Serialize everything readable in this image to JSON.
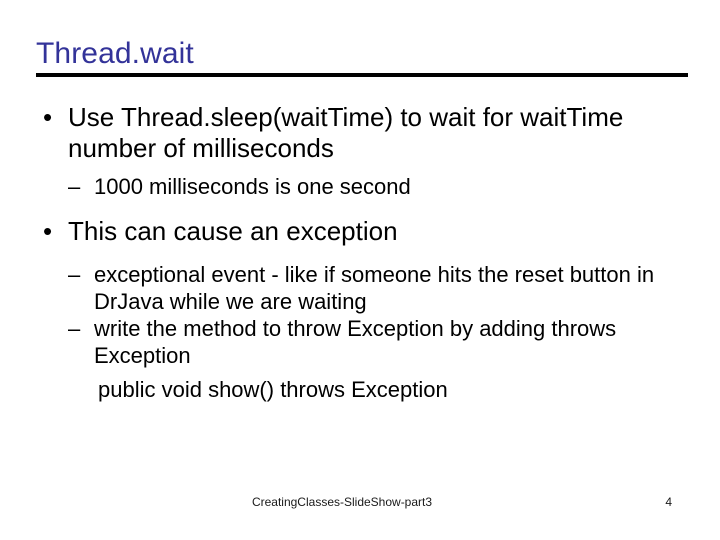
{
  "slide": {
    "title": "Thread.wait",
    "title_color": "#333399",
    "rule_color": "#000000",
    "background": "#ffffff",
    "body": [
      {
        "level": 1,
        "marker": "•",
        "text": "Use Thread.sleep(waitTime) to wait for waitTime number of milliseconds"
      },
      {
        "level": 2,
        "marker": "–",
        "text": "1000 milliseconds is one second"
      },
      {
        "level": 1,
        "marker": "•",
        "text": "This can cause an exception"
      },
      {
        "level": 2,
        "marker": "–",
        "text": "exceptional event - like if someone hits the reset button in DrJava while we are waiting"
      },
      {
        "level": 2,
        "marker": "–",
        "text": "write the method to throw Exception by adding throws Exception"
      },
      {
        "level": 2,
        "marker": "",
        "text": "public void show() throws Exception"
      }
    ],
    "footer": {
      "text": "CreatingClasses-SlideShow-part3",
      "page_number": "4"
    }
  }
}
